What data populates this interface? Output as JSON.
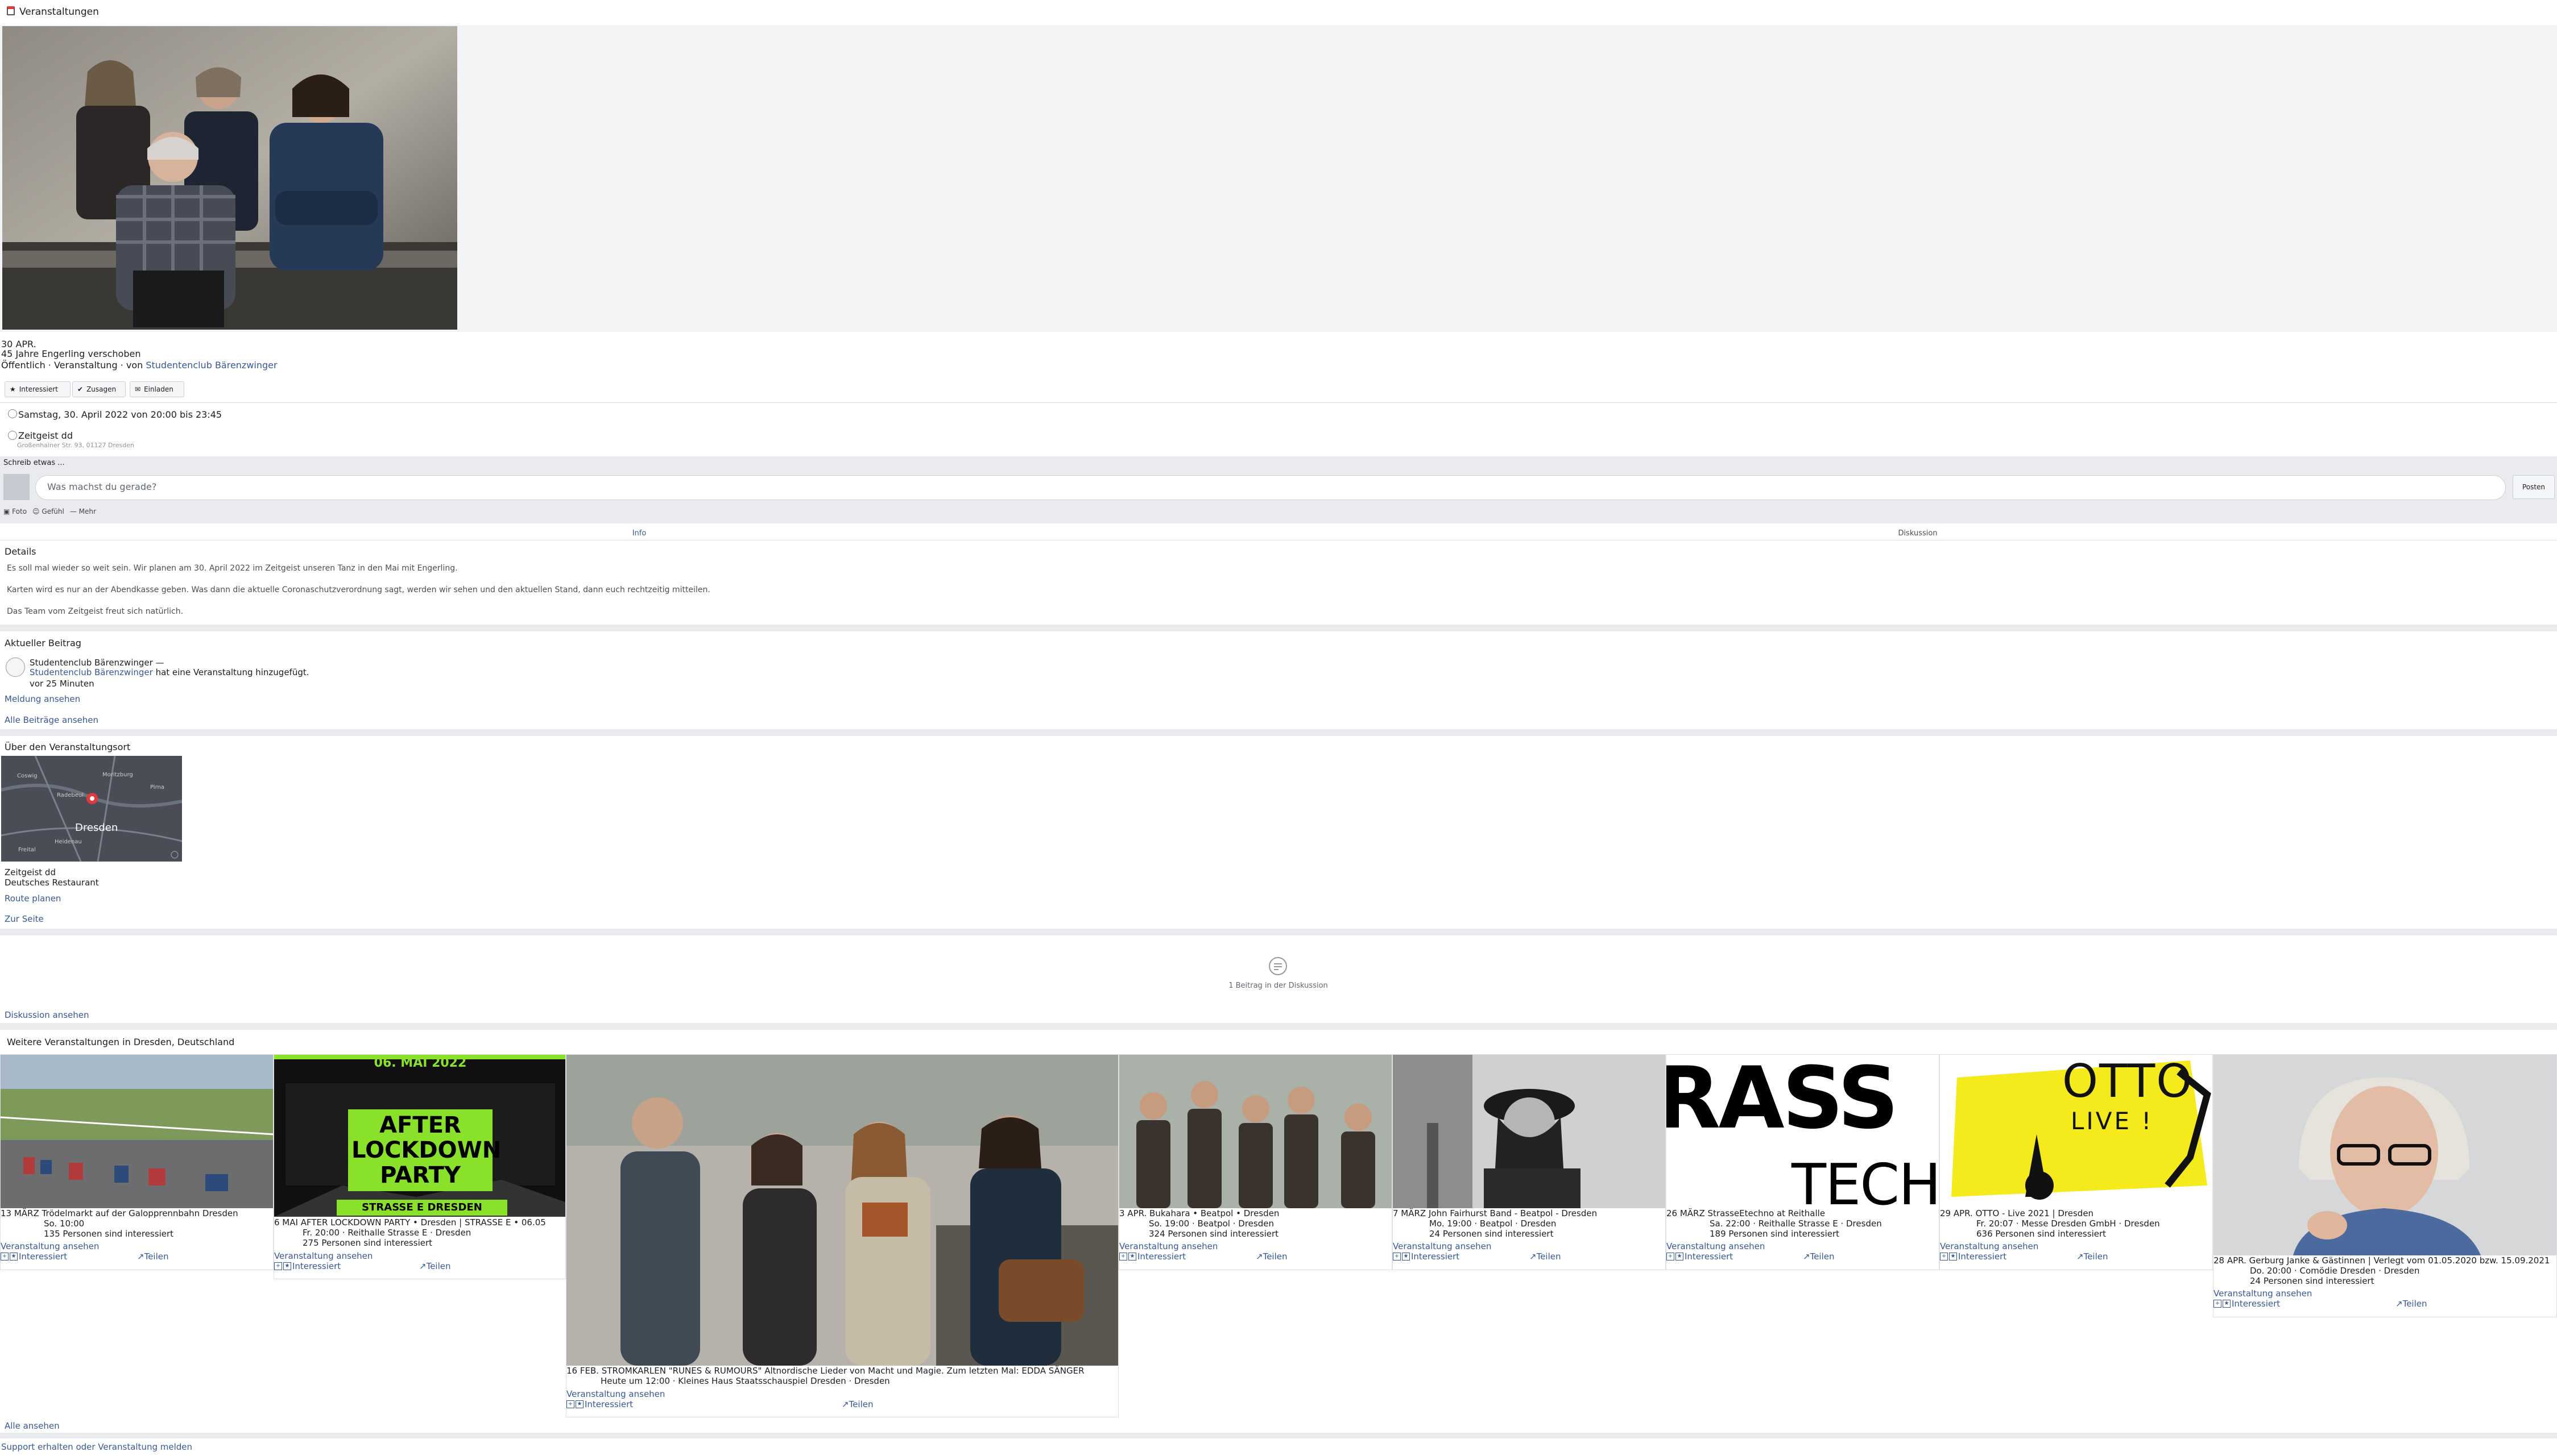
{
  "header": {
    "title": "Veranstaltungen"
  },
  "event": {
    "date": "30 APR.",
    "title": "45 Jahre Engerling verschoben",
    "meta_prefix": "Öffentlich · Veranstaltung · von ",
    "organizer": "Studentenclub Bärenzwinger",
    "actions": [
      "Interessiert",
      "Zusagen",
      "Einladen"
    ],
    "time": "Samstag, 30. April 2022 von 20:00 bis 23:45",
    "place": "Zeitgeist dd",
    "address": "Großenhainer Str. 93, 01127 Dresden"
  },
  "composer": {
    "label": "Schreib etwas ...",
    "placeholder": "Was machst du gerade?",
    "post": "Posten",
    "tools": [
      "Foto",
      "Gefühl",
      "Mehr"
    ]
  },
  "tabs": [
    "Info",
    "Diskussion"
  ],
  "details": {
    "heading": "Details",
    "paragraphs": [
      "Es soll mal wieder so weit sein. Wir planen am 30. April 2022 im Zeitgeist unseren Tanz in den Mai mit Engerling.",
      "Karten wird es nur an der Abendkasse geben. Was dann die aktuelle Coronaschutzverordnung sagt, werden wir sehen und den aktuellen Stand, dann euch rechtzeitig mitteilen.",
      "Das Team vom Zeitgeist freut sich natürlich."
    ]
  },
  "recent_post": {
    "heading": "Aktueller Beitrag",
    "author": "Studentenclub Bärenzwinger —",
    "author_link": "Studentenclub Bärenzwinger",
    "action": " hat eine Veranstaltung hinzugefügt.",
    "time": "vor 25 Minuten",
    "view_report": "Meldung ansehen",
    "all_posts": "Alle Beiträge ansehen"
  },
  "venue": {
    "heading": "Über den Veranstaltungsort",
    "map_city": "Dresden",
    "map_labels": [
      "Coswig",
      "Radebeul",
      "Moritzburg",
      "Pirna",
      "Freital",
      "Heidenau"
    ],
    "name": "Zeitgeist dd",
    "type": "Deutsches Restaurant",
    "route": "Route planen",
    "page": "Zur Seite"
  },
  "discussion": {
    "count": "1 Beitrag in der Diskussion",
    "view": "Diskussion ansehen"
  },
  "more_events": {
    "heading": "Weitere Veranstaltungen in Dresden, Deutschland",
    "view_label": "Veranstaltung ansehen",
    "interest_label": "Interessiert",
    "share_label": "Teilen",
    "all": "Alle ansehen",
    "items": [
      {
        "caption": "13 MÄRZ Trödelmarkt auf der Galopprennbahn Dresden",
        "when": "So. 10:00",
        "people": "135 Personen sind interessiert"
      },
      {
        "caption": "6 MAI AFTER LOCKDOWN PARTY • Dresden | STRASSE E • 06.05",
        "when": "Fr. 20:00 · Reithalle Strasse E · Dresden",
        "people": "275 Personen sind interessiert",
        "poster_top": "06. MAI 2022",
        "poster_main": "AFTER LOCKDOWN PARTY",
        "poster_sub": "STRASSE E DRESDEN"
      },
      {
        "caption": "16 FEB. STROMKARLEN \"RUNES & RUMOURS\" Altnordische Lieder von Macht und Magie. Zum letzten Mal: EDDA SÄNGER",
        "when": "Heute um 12:00 · Kleines Haus Staatsschauspiel Dresden · Dresden",
        "people": ""
      },
      {
        "caption": "3 APR. Bukahara • Beatpol • Dresden",
        "when": "So. 19:00 · Beatpol · Dresden",
        "people": "324 Personen sind interessiert"
      },
      {
        "caption": "7 MÄRZ John Fairhurst Band - Beatpol - Dresden",
        "when": "Mo. 19:00 · Beatpol · Dresden",
        "people": "24 Personen sind interessiert"
      },
      {
        "caption": "26 MÄRZ StrasseEtechno at Reithalle",
        "when": "Sa. 22:00 · Reithalle Strasse E · Dresden",
        "people": "189 Personen sind interessiert",
        "poster_top": "RASS",
        "poster_sub": "TECH"
      },
      {
        "caption": "29 APR. OTTO - Live 2021 | Dresden",
        "when": "Fr. 20:07 · Messe Dresden GmbH · Dresden",
        "people": "636 Personen sind interessiert",
        "poster_top": "OTTO",
        "poster_sub": "LIVE !"
      },
      {
        "caption": "28 APR. Gerburg Janke & Gästinnen | Verlegt vom 01.05.2020 bzw. 15.09.2021",
        "when": "Do. 20:00 · Comödie Dresden · Dresden",
        "people": "24 Personen sind interessiert"
      }
    ]
  },
  "footer": {
    "support": "Support erhalten oder Veranstaltung melden"
  }
}
